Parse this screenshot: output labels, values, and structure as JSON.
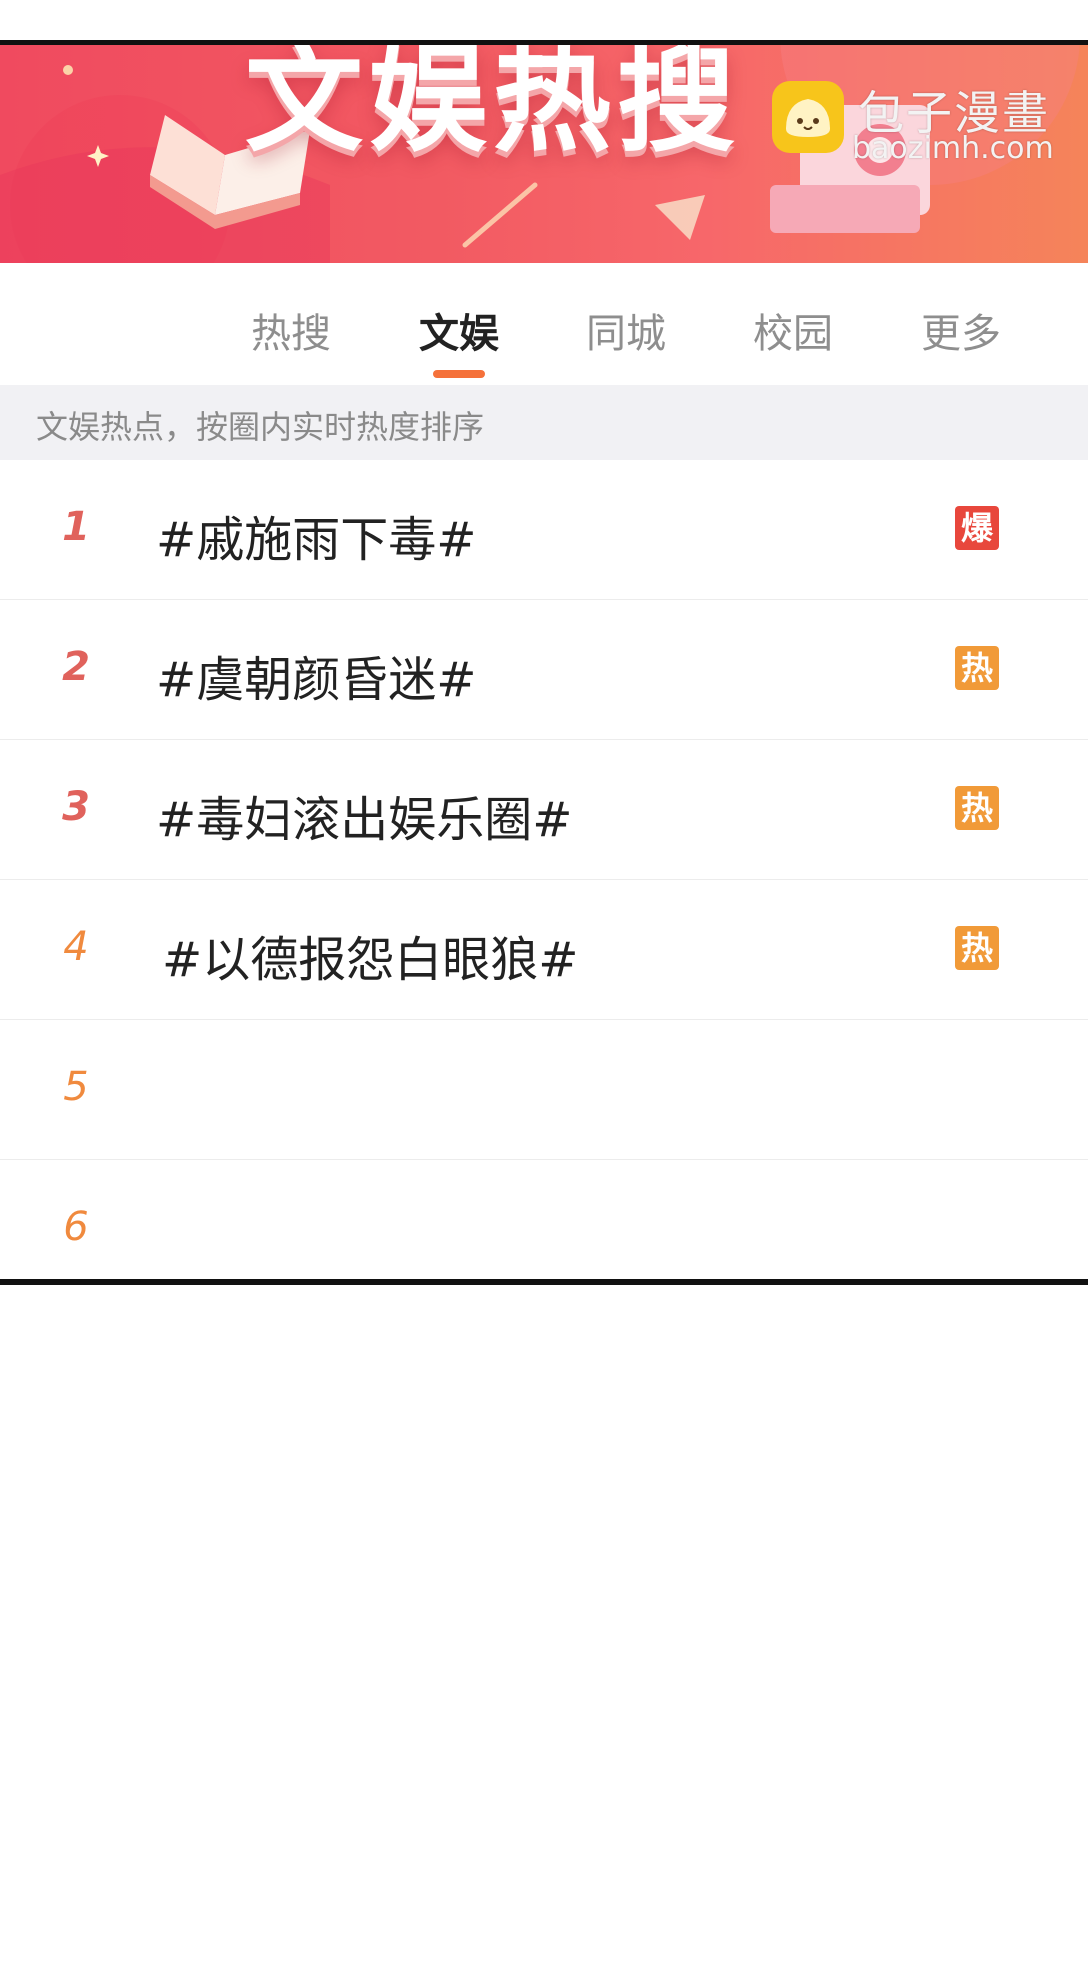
{
  "banner": {
    "title": "文娱热搜"
  },
  "watermark": {
    "name": "包子漫畫",
    "domain": "baozimh.com"
  },
  "tabs": [
    {
      "label": "热搜",
      "active": false
    },
    {
      "label": "文娱",
      "active": true
    },
    {
      "label": "同城",
      "active": false
    },
    {
      "label": "校园",
      "active": false
    },
    {
      "label": "更多",
      "active": false
    }
  ],
  "subheader": {
    "text": "文娱热点，按圈内实时热度排序"
  },
  "colors": {
    "accent": "#f5713a",
    "badge_explosive": "#e8473c",
    "badge_hot": "#f19a38",
    "rank_top": "#e0625c",
    "rank_other": "#f08a3e"
  },
  "hot_list": [
    {
      "rank": "1",
      "title": "#戚施雨下毒#",
      "badge": "爆",
      "badge_type": "explosive"
    },
    {
      "rank": "2",
      "title": "#虞朝颜昏迷#",
      "badge": "热",
      "badge_type": "hot"
    },
    {
      "rank": "3",
      "title": "#毒妇滚出娱乐圈#",
      "badge": "热",
      "badge_type": "hot"
    },
    {
      "rank": "4",
      "title": "#以德报怨白眼狼#",
      "badge": "热",
      "badge_type": "hot"
    },
    {
      "rank": "5",
      "title": "",
      "badge": "",
      "badge_type": ""
    },
    {
      "rank": "6",
      "title": "",
      "badge": "",
      "badge_type": ""
    }
  ]
}
